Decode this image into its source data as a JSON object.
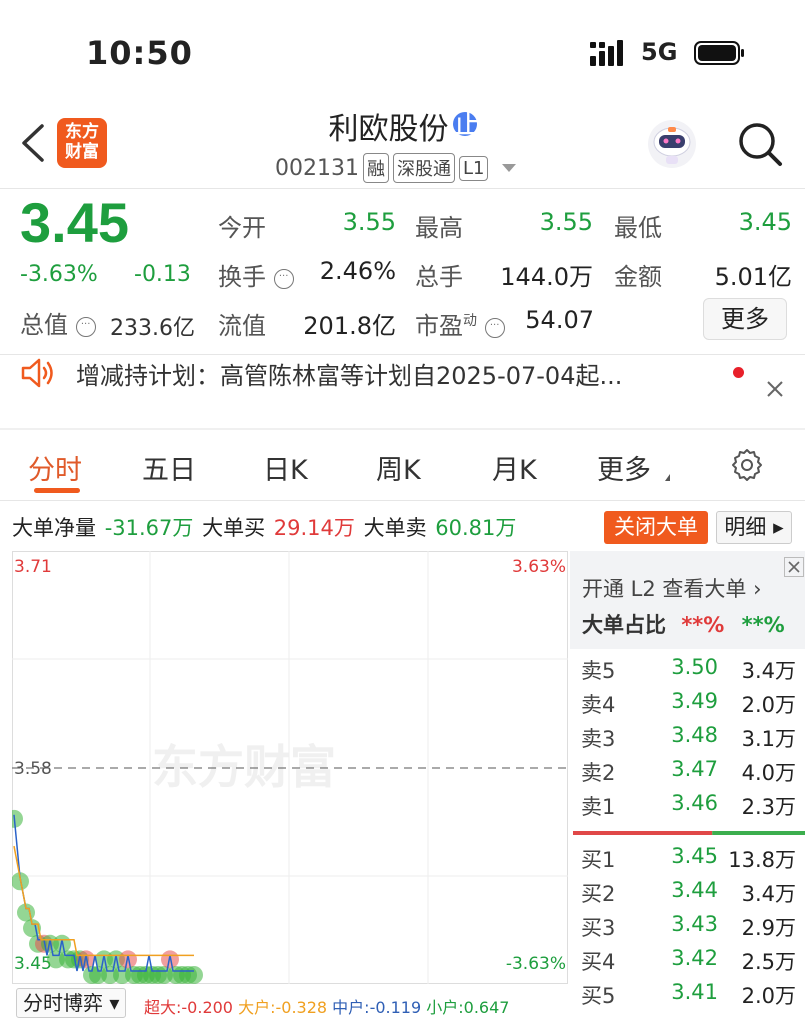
{
  "status_bar": {
    "time": "10:50",
    "network": "5G"
  },
  "header": {
    "logo_line1": "东方",
    "logo_line2": "财富",
    "stock_name": "利欧股份",
    "badge": "正",
    "code": "002131",
    "tags": [
      "融",
      "深股通",
      "L1"
    ]
  },
  "quote": {
    "price": "3.45",
    "change_pct": "-3.63%",
    "change_abs": "-0.13",
    "market_cap_label": "总值",
    "market_cap_value": "233.6亿",
    "fields": [
      {
        "label": "今开",
        "value": "3.55"
      },
      {
        "label": "最高",
        "value": "3.55"
      },
      {
        "label": "最低",
        "value": "3.45"
      },
      {
        "label": "换手",
        "value": "2.46%"
      },
      {
        "label": "总手",
        "value": "144.0万"
      },
      {
        "label": "金额",
        "value": "5.01亿"
      },
      {
        "label": "流值",
        "value": "201.8亿"
      },
      {
        "label": "市盈",
        "label_sup": "动",
        "value": "54.07"
      }
    ],
    "more_label": "更多"
  },
  "notice": {
    "text": "增减持计划：高管陈林富等计划自2025-07-04起..."
  },
  "tabs": [
    {
      "label": "分时",
      "active": true
    },
    {
      "label": "五日",
      "active": false
    },
    {
      "label": "日K",
      "active": false
    },
    {
      "label": "周K",
      "active": false
    },
    {
      "label": "月K",
      "active": false
    },
    {
      "label": "更多",
      "active": false
    }
  ],
  "large_orders": {
    "net_label": "大单净量",
    "net_value": "-31.67万",
    "buy_label": "大单买",
    "buy_value": "29.14万",
    "sell_label": "大单卖",
    "sell_value": "60.81万",
    "close_button": "关闭大单",
    "detail_button": "明细"
  },
  "chart_data": {
    "type": "line",
    "y_top_label": "3.71",
    "y_mid_label": "3.58",
    "y_bottom_label": "3.45",
    "pct_top_label": "3.63%",
    "pct_bottom_label": "-3.63%",
    "ylim": [
      3.45,
      3.71
    ],
    "reference_price": 3.58,
    "watermark": "东方财富",
    "price_series": [
      3.55,
      3.53,
      3.51,
      3.5,
      3.49,
      3.49,
      3.48,
      3.48,
      3.47,
      3.47,
      3.47,
      3.46,
      3.47,
      3.46,
      3.46,
      3.46,
      3.47,
      3.46,
      3.46,
      3.46,
      3.46,
      3.45,
      3.46,
      3.45,
      3.46,
      3.45,
      3.45,
      3.46,
      3.45,
      3.45,
      3.46,
      3.45,
      3.45,
      3.45,
      3.46,
      3.45,
      3.45,
      3.45,
      3.46,
      3.45,
      3.45,
      3.45,
      3.45,
      3.45,
      3.45,
      3.46,
      3.45,
      3.45,
      3.45,
      3.45,
      3.45,
      3.45,
      3.46,
      3.45,
      3.45,
      3.45,
      3.45,
      3.45,
      3.45,
      3.45,
      3.45
    ],
    "avg_series": [
      3.53,
      3.52,
      3.51,
      3.5,
      3.49,
      3.49,
      3.48,
      3.48,
      3.48,
      3.47,
      3.47,
      3.47,
      3.47,
      3.47,
      3.47,
      3.47,
      3.47,
      3.47,
      3.47,
      3.47,
      3.47,
      3.46,
      3.46,
      3.46,
      3.46,
      3.46,
      3.46,
      3.46,
      3.46,
      3.46,
      3.46,
      3.46,
      3.46,
      3.46,
      3.46,
      3.46,
      3.46,
      3.46,
      3.46,
      3.46,
      3.46,
      3.46,
      3.46,
      3.46,
      3.46,
      3.46,
      3.46,
      3.46,
      3.46,
      3.46,
      3.46,
      3.46,
      3.46,
      3.46,
      3.46,
      3.46,
      3.46,
      3.46,
      3.46,
      3.46,
      3.46
    ]
  },
  "chart_footer": {
    "mode": "分时博弈",
    "super_label": "超大:",
    "super_value": "-0.200",
    "big_label": "大户:",
    "big_value": "-0.328",
    "mid_label": "中户:",
    "mid_value": "-0.119",
    "small_label": "小户:",
    "small_value": "0.647"
  },
  "order_book": {
    "l2_link": "开通 L2 查看大单",
    "ratio_label": "大单占比",
    "ratio_red": "**%",
    "ratio_green": "**%",
    "asks": [
      {
        "label": "卖5",
        "price": "3.50",
        "volume": "3.4万"
      },
      {
        "label": "卖4",
        "price": "3.49",
        "volume": "2.0万"
      },
      {
        "label": "卖3",
        "price": "3.48",
        "volume": "3.1万"
      },
      {
        "label": "卖2",
        "price": "3.47",
        "volume": "4.0万"
      },
      {
        "label": "卖1",
        "price": "3.46",
        "volume": "2.3万"
      }
    ],
    "bids": [
      {
        "label": "买1",
        "price": "3.45",
        "volume": "13.8万"
      },
      {
        "label": "买2",
        "price": "3.44",
        "volume": "3.4万"
      },
      {
        "label": "买3",
        "price": "3.43",
        "volume": "2.9万"
      },
      {
        "label": "买4",
        "price": "3.42",
        "volume": "2.5万"
      },
      {
        "label": "买5",
        "price": "3.41",
        "volume": "2.0万"
      }
    ],
    "split_red_fraction": 0.6
  },
  "colors": {
    "down": "#1e9e3e",
    "up": "#e03a3a",
    "accent": "#f05a1e",
    "avg_line": "#f0a020"
  }
}
